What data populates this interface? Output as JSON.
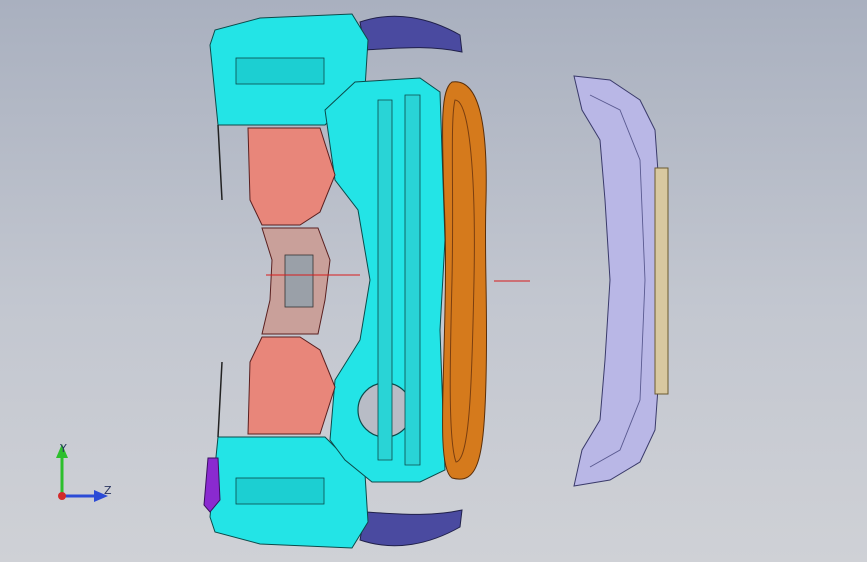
{
  "viewport": {
    "background_top": "#a9b0bf",
    "background_bottom": "#cfd1d6"
  },
  "parts": [
    {
      "name": "front-end-module-frame",
      "color": "#23e4e6"
    },
    {
      "name": "inner-panel-left",
      "color": "#e8867a"
    },
    {
      "name": "radiator-fan-assembly",
      "color": "#d57a1c"
    },
    {
      "name": "front-bumper-fascia",
      "color": "#b9b7e6"
    },
    {
      "name": "bumper-reinforcement-strip",
      "color": "#d8c8a0"
    },
    {
      "name": "headlamp-brackets",
      "color": "#4a4aa0"
    },
    {
      "name": "tow-bracket",
      "color": "#8a2ad0"
    }
  ],
  "axes": {
    "y_label": "Y",
    "z_label": "Z",
    "y_color": "#2dbf2d",
    "z_color": "#2b4bd6",
    "x_color": "#d22a2a"
  },
  "centerline": {
    "color": "#d81c1c"
  }
}
